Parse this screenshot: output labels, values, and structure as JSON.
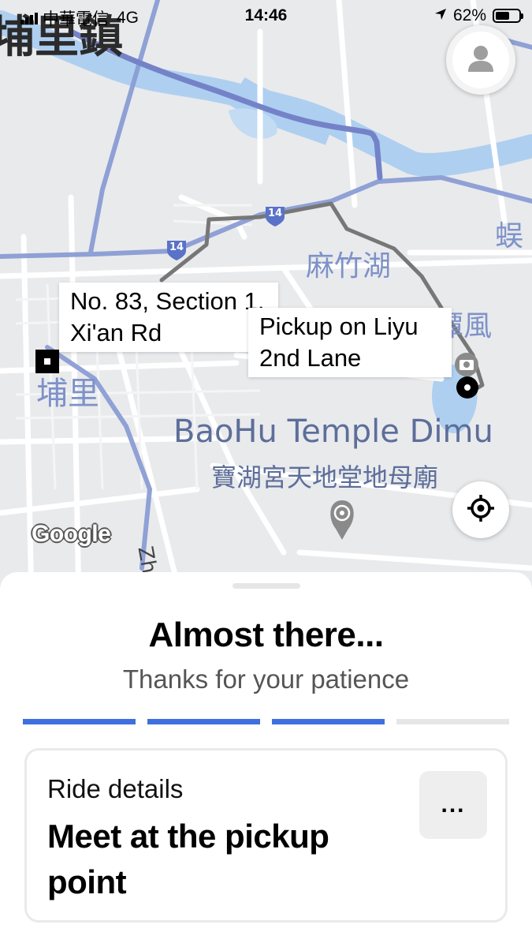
{
  "status_bar": {
    "carrier": "中華電信",
    "network": "4G",
    "time": "14:46",
    "battery": "62%",
    "battery_level": 0.62
  },
  "map": {
    "town_label": "埔里鎮",
    "district_label": "埔里",
    "lake_label": "麻竹湖",
    "partial_label_1": "埔里鎮魚潭風",
    "partial_label_2": "蜈",
    "partial_label_3": "Zho",
    "temple_name_en": "BaoHu Temple Dimu",
    "temple_name_zh": "寶湖宮天地堂地母廟",
    "route_shield_1": "14",
    "route_shield_2": "14",
    "destination_label": "No. 83, Section 1, Xi'an Rd",
    "pickup_label": "Pickup on Liyu 2nd Lane",
    "attribution": "Google",
    "colors": {
      "water": "#aecff0",
      "highway": "#8a9dd4",
      "route": "#777777"
    }
  },
  "buttons": {
    "profile_icon": "person-icon",
    "locate_icon": "crosshair-icon"
  },
  "sheet": {
    "title": "Almost there...",
    "subtitle": "Thanks for your patience",
    "progress": {
      "segments_total": 4,
      "segments_complete": 3,
      "active_color": "#3d6fdf",
      "inactive_color": "#e6e6e6"
    },
    "card": {
      "label": "Ride details",
      "title": "Meet at the pickup point",
      "more_label": "..."
    }
  }
}
